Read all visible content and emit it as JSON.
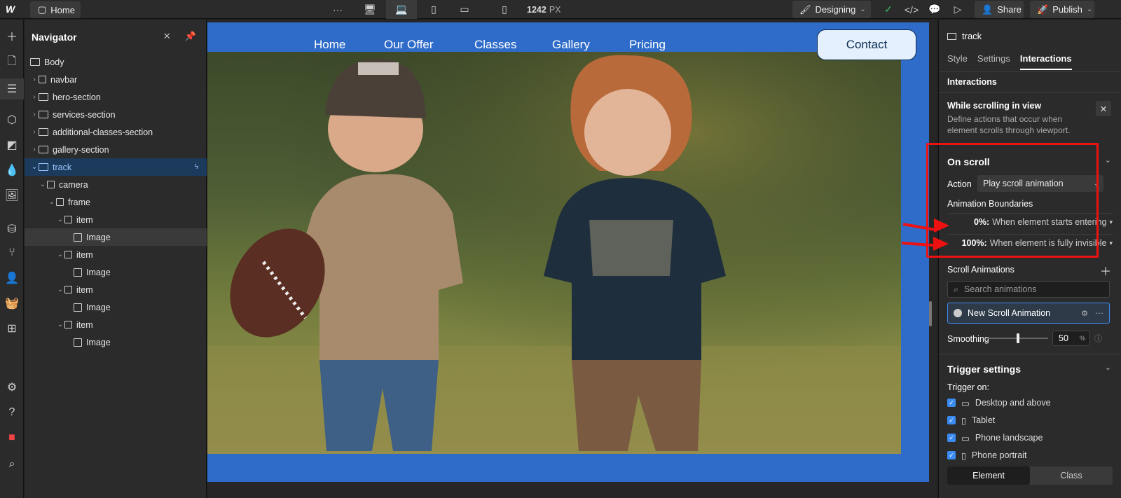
{
  "topbar": {
    "home_label": "Home",
    "more_label": "···",
    "width_value": "1242",
    "width_unit": "PX",
    "mode_label": "Designing",
    "share_label": "Share",
    "publish_label": "Publish"
  },
  "navigator": {
    "title": "Navigator",
    "items": [
      {
        "label": "Body"
      },
      {
        "label": "navbar"
      },
      {
        "label": "hero-section"
      },
      {
        "label": "services-section"
      },
      {
        "label": "additional-classes-section"
      },
      {
        "label": "gallery-section"
      },
      {
        "label": "track"
      },
      {
        "label": "camera"
      },
      {
        "label": "frame"
      },
      {
        "label": "item"
      },
      {
        "label": "Image"
      },
      {
        "label": "item"
      },
      {
        "label": "Image"
      },
      {
        "label": "item"
      },
      {
        "label": "Image"
      },
      {
        "label": "item"
      },
      {
        "label": "Image"
      }
    ]
  },
  "site": {
    "nav": [
      "Home",
      "Our Offer",
      "Classes",
      "Gallery",
      "Pricing"
    ],
    "contact_label": "Contact"
  },
  "panel": {
    "element_name": "track",
    "tabs": [
      "Style",
      "Settings",
      "Interactions"
    ],
    "section_title": "Interactions",
    "trigger_title": "While scrolling in view",
    "trigger_desc": "Define actions that occur when element scrolls through viewport.",
    "on_scroll_title": "On scroll",
    "action_label": "Action",
    "action_value": "Play scroll animation",
    "boundaries_title": "Animation Boundaries",
    "boundary_start_pct": "0%:",
    "boundary_start_text": "When element starts entering",
    "boundary_end_pct": "100%:",
    "boundary_end_text": "When element is fully invisible",
    "scroll_anims_title": "Scroll Animations",
    "search_placeholder": "Search animations",
    "animation_name": "New Scroll Animation",
    "smoothing_label": "Smoothing",
    "smoothing_value": "50",
    "smoothing_unit": "%",
    "trigger_settings_title": "Trigger settings",
    "trigger_on_label": "Trigger on:",
    "devices": [
      "Desktop and above",
      "Tablet",
      "Phone landscape",
      "Phone portrait"
    ],
    "seg_element": "Element",
    "seg_class": "Class"
  },
  "colors": {
    "site_bg": "#2f6cc9",
    "accent": "#3b8cf2",
    "highlight_red": "#e11111"
  }
}
